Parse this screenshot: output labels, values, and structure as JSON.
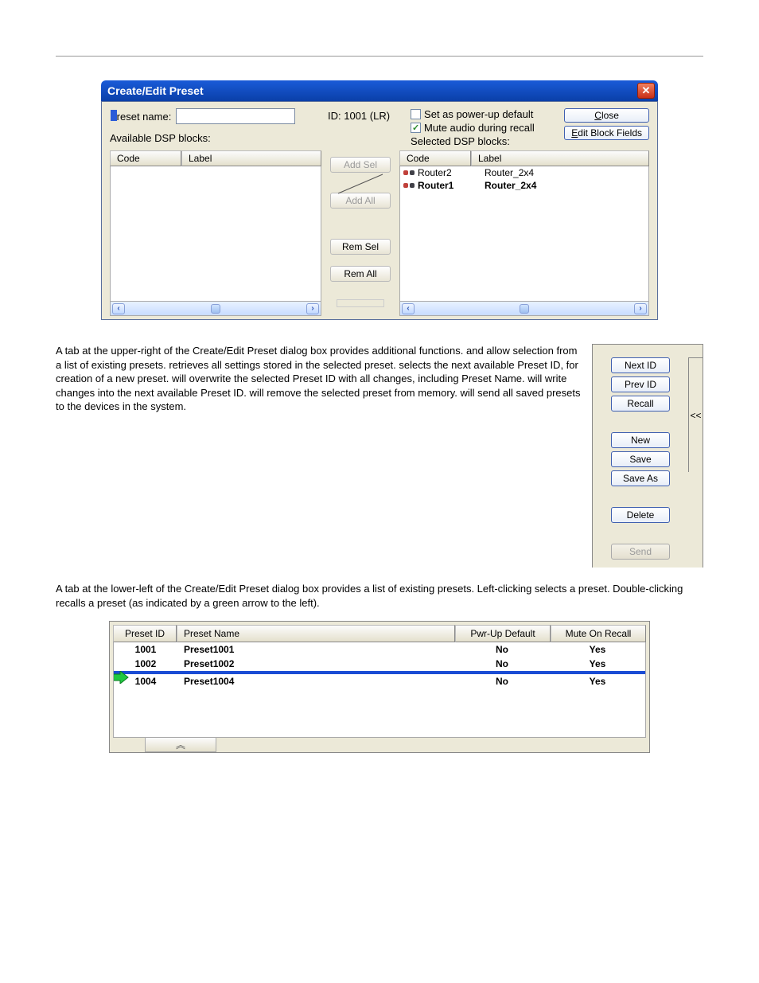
{
  "dialog": {
    "title": "Create/Edit Preset",
    "preset_name_label": "Preset name:",
    "preset_name_value": "",
    "id_label": "ID: 1001 (LR)",
    "chk_powerup": "Set as power-up default",
    "chk_mute": "Mute audio during recall",
    "btn_close": "Close",
    "btn_edit_fields": "Edit Block Fields",
    "available_label": "Available DSP blocks:",
    "selected_label": "Selected DSP blocks:",
    "col_code": "Code",
    "col_label": "Label",
    "transfer": {
      "add_sel": "Add Sel",
      "add_all": "Add All",
      "rem_sel": "Rem Sel",
      "rem_all": "Rem All"
    },
    "selected_rows": [
      {
        "code": "Router2",
        "label": "Router_2x4",
        "bold": false
      },
      {
        "code": "Router1",
        "label": "Router_2x4",
        "bold": true
      }
    ]
  },
  "para1_a": "A tab at the upper-right of the Create/Edit Preset dialog box provides additional functions. ",
  "para1_b": " and ",
  "para1_c": " allow selection from a list of existing presets. ",
  "para1_d": " retrieves all settings stored in the selected preset. ",
  "para1_e": " selects the next available Preset ID, for creation of a new preset. ",
  "para1_f": " will overwrite the selected Preset ID with all changes, including Preset Name. ",
  "para1_g": " will write changes into the next available Preset ID. ",
  "para1_h": " will remove the selected preset from memory. ",
  "para1_i": " will send all saved presets to the devices in the system.",
  "sidebtns": {
    "next": "Next ID",
    "prev": "Prev ID",
    "recall": "Recall",
    "new": "New",
    "save": "Save",
    "saveas": "Save As",
    "delete": "Delete",
    "send": "Send",
    "collapse": "<<"
  },
  "para2": "A tab at the lower-left of the Create/Edit Preset dialog box provides a list of existing presets. Left-clicking selects a preset. Double-clicking recalls a preset (as indicated by a green arrow to the left).",
  "ptable": {
    "h_id": "Preset ID",
    "h_name": "Preset Name",
    "h_pwr": "Pwr-Up Default",
    "h_mute": "Mute On Recall",
    "rows": [
      {
        "id": "1001",
        "name": "Preset1001",
        "pwr": "No",
        "mute": "Yes",
        "selected": false,
        "arrow": false
      },
      {
        "id": "1002",
        "name": "Preset1002",
        "pwr": "No",
        "mute": "Yes",
        "selected": false,
        "arrow": false
      },
      {
        "id": "",
        "name": "",
        "pwr": "",
        "mute": "",
        "selected": true,
        "arrow": true
      },
      {
        "id": "1004",
        "name": "Preset1004",
        "pwr": "No",
        "mute": "Yes",
        "selected": false,
        "arrow": false
      }
    ],
    "collapse": "︽"
  }
}
